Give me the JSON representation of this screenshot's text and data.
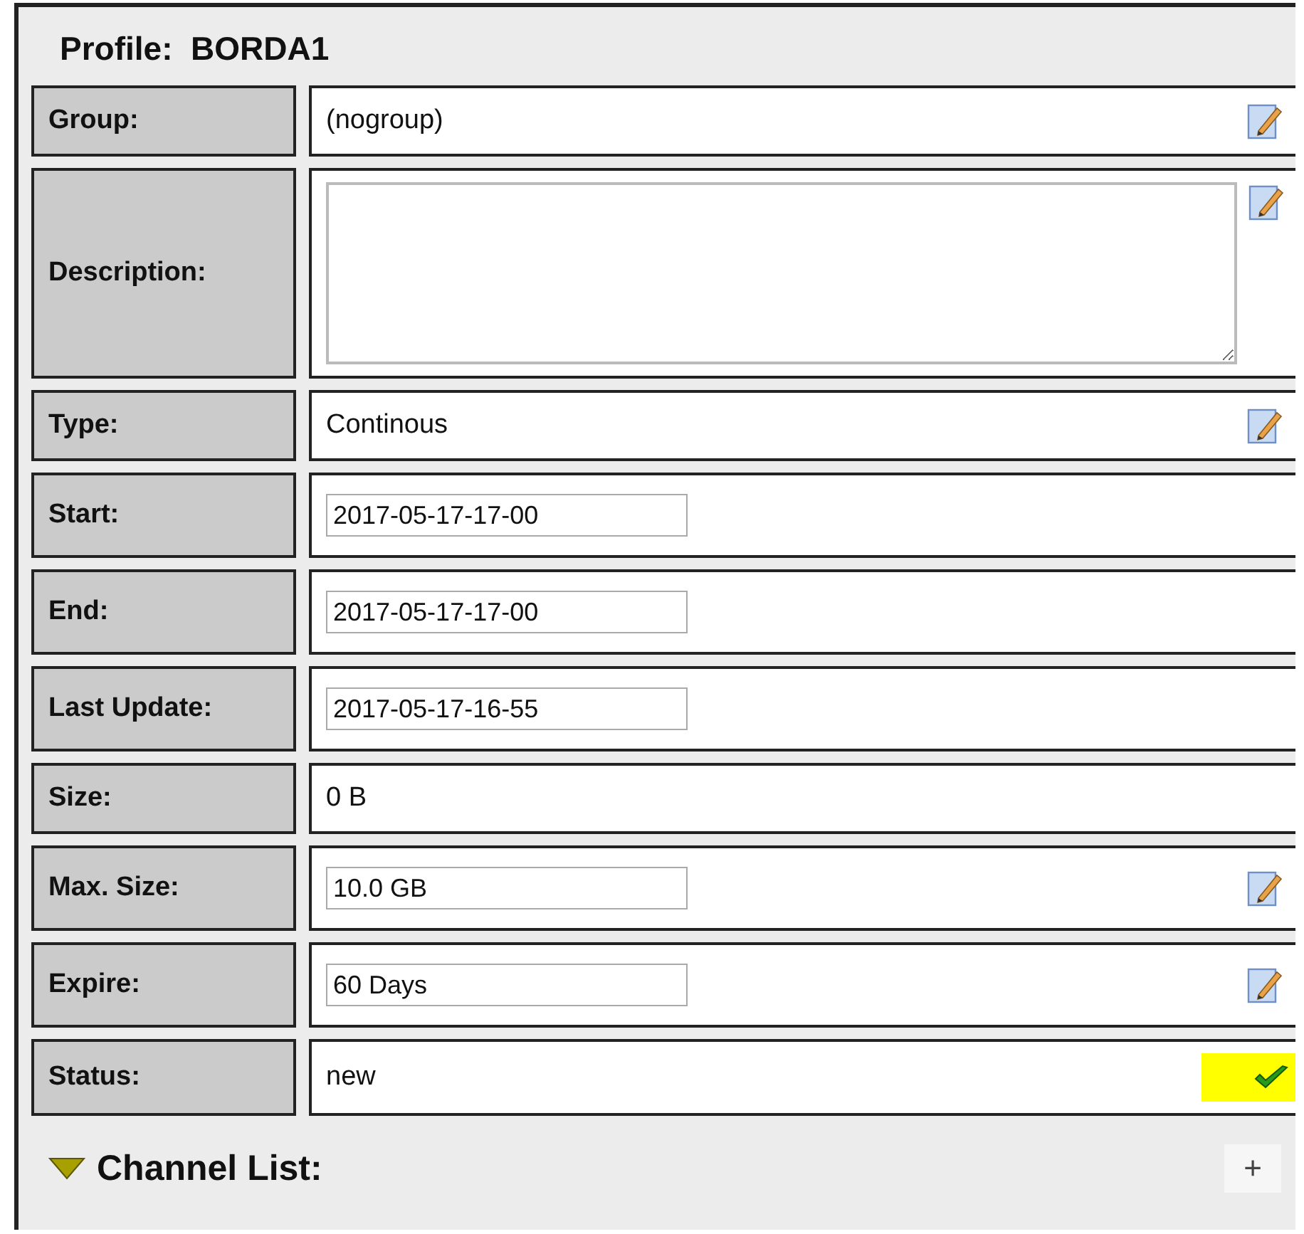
{
  "title": "Profile:  BORDA1",
  "fields": [
    {
      "label": "Group:",
      "kind": "text",
      "value": "(nogroup)",
      "editable": true
    },
    {
      "label": "Description:",
      "kind": "textarea",
      "editable": true
    },
    {
      "label": "Type:",
      "kind": "text",
      "value": "Continous",
      "editable": true
    },
    {
      "label": "Start:",
      "kind": "input",
      "value": "2017-05-17-17-00",
      "editable": false
    },
    {
      "label": "End:",
      "kind": "input",
      "value": "2017-05-17-17-00",
      "editable": false
    },
    {
      "label": "Last Update:",
      "kind": "input",
      "value": "2017-05-17-16-55",
      "editable": false
    },
    {
      "label": "Size:",
      "kind": "text",
      "value": "0 B",
      "editable": false
    },
    {
      "label": "Max. Size:",
      "kind": "input",
      "value": "10.0 GB",
      "editable": true
    },
    {
      "label": "Expire:",
      "kind": "input",
      "value": "60 Days",
      "editable": true
    },
    {
      "label": "Status:",
      "kind": "text",
      "value": "new",
      "editable": false,
      "verified": true
    }
  ],
  "channel_list": {
    "title": "Channel List:",
    "expanded": true,
    "add_button": "+"
  }
}
